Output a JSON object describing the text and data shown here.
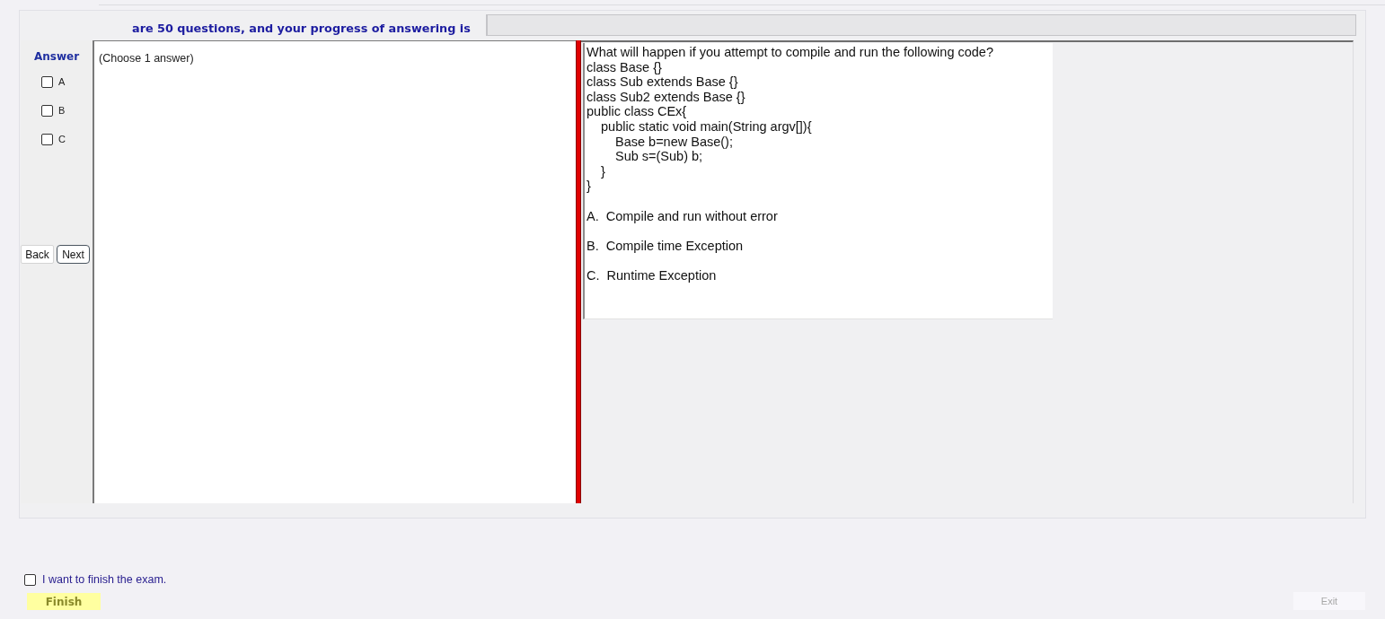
{
  "header": {
    "text": "are 50 questions, and your progress of answering is"
  },
  "progress": {
    "level": 0
  },
  "answer_panel": {
    "title": "Answer",
    "options": [
      {
        "label": "A",
        "checked": false
      },
      {
        "label": "B",
        "checked": false
      },
      {
        "label": "C",
        "checked": false
      }
    ]
  },
  "nav_buttons": [
    {
      "label": "Back",
      "focused": false
    },
    {
      "label": "Next",
      "focused": true
    }
  ],
  "answer_box": {
    "instruction": "(Choose 1 answer)"
  },
  "question": {
    "prompt": "What will happen if you attempt to compile and run the following code?",
    "code": [
      {
        "text": "class Base {}"
      },
      {
        "text": "class Sub extends Base {}"
      },
      {
        "text": "class Sub2 extends Base {}"
      },
      {
        "text": "public class CEx{",
        "children": [
          {
            "text": "public static void main(String argv[]){",
            "children": [
              {
                "text": "Base b=new Base();"
              },
              {
                "text": "Sub s=(Sub) b;"
              }
            ]
          },
          {
            "text": "}"
          }
        ]
      },
      {
        "text": "}"
      }
    ],
    "options": [
      "A.  Compile and run without error",
      "B.  Compile time Exception",
      "C.  Runtime Exception"
    ]
  },
  "finish": {
    "confirm": {
      "label": "I want to finish the exam.",
      "checked": false
    },
    "button": {
      "label": "Finish",
      "disabled": false
    }
  },
  "exit_button": {
    "label": "Exit",
    "disabled": true
  }
}
